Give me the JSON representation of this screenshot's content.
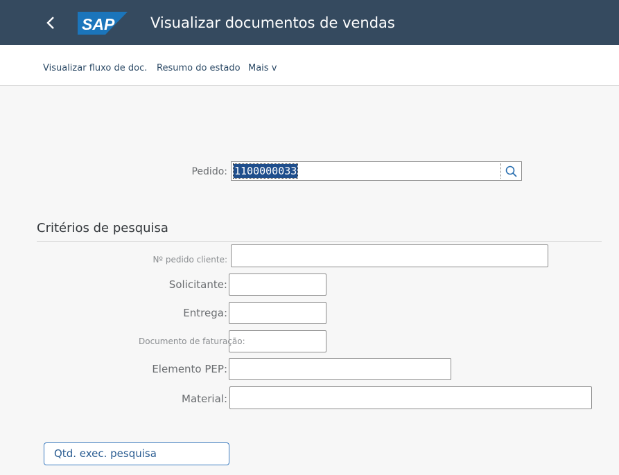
{
  "header": {
    "title": "Visualizar documentos de vendas",
    "logo_text": "SAP",
    "back_icon": "chevron-left-icon",
    "colors": {
      "bar": "#354a5f",
      "logo": "#1b75bb"
    }
  },
  "toolbar": {
    "items": [
      "Visualizar fluxo de doc.",
      "Resumo do estado",
      "Mais v"
    ]
  },
  "order": {
    "label": "Pedido:",
    "value": "1100000033",
    "search_icon": "search-icon"
  },
  "search_criteria": {
    "title": "Critérios de pesquisa",
    "fields": [
      {
        "label": "Nº pedido cliente:",
        "value": ""
      },
      {
        "label": "Solicitante:",
        "value": ""
      },
      {
        "label": "Entrega:",
        "value": ""
      },
      {
        "label": "Documento de faturação:",
        "value": ""
      },
      {
        "label": "Elemento PEP:",
        "value": ""
      },
      {
        "label": "Material:",
        "value": ""
      }
    ]
  },
  "actions": {
    "exec_search": "Qtd. exec. pesquisa"
  }
}
